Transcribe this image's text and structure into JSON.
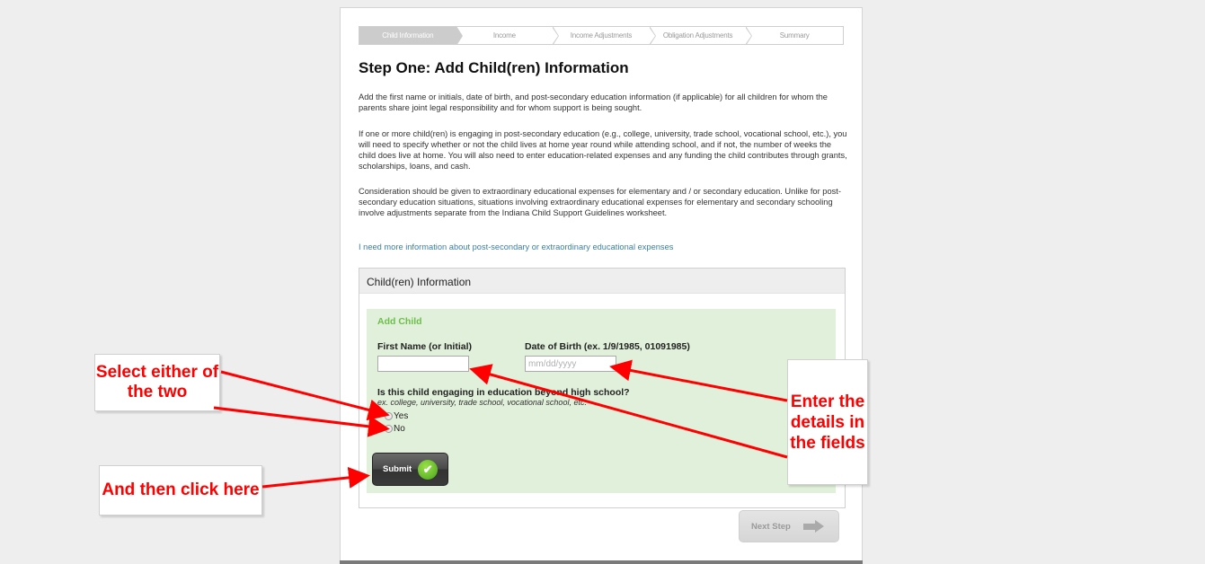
{
  "stepper": {
    "steps": [
      {
        "label": "Child Information",
        "active": true
      },
      {
        "label": "Income",
        "active": false
      },
      {
        "label": "Income Adjustments",
        "active": false
      },
      {
        "label": "Obligation Adjustments",
        "active": false
      },
      {
        "label": "Summary",
        "active": false
      }
    ]
  },
  "page": {
    "title": "Step One: Add Child(ren) Information",
    "paragraphs": [
      "Add the first name or initials, date of birth, and post-secondary education information (if applicable) for all children for whom the parents share joint legal responsibility and for whom support is being sought.",
      "If one or more child(ren) is engaging in post-secondary education (e.g., college, university, trade school, vocational school, etc.), you will need to specify whether or not the child lives at home year round while attending school, and if not, the number of weeks the child does live at home. You will also need to enter education-related expenses and any funding the child contributes through grants, scholarships, loans, and cash.",
      "Consideration should be given to extraordinary educational expenses for elementary and / or secondary education. Unlike for post-secondary education situations, situations involving extraordinary educational expenses for elementary and secondary schooling involve adjustments separate from the Indiana Child Support Guidelines worksheet."
    ],
    "info_link": "I need more information about post-secondary or extraordinary educational expenses"
  },
  "panel": {
    "title": "Child(ren) Information",
    "add_child": {
      "title": "Add Child",
      "first_name_label": "First Name (or Initial)",
      "first_name_value": "",
      "dob_label": "Date of Birth (ex. 1/9/1985, 01091985)",
      "dob_value": "",
      "dob_placeholder": "mm/dd/yyyy",
      "question": "Is this child engaging in education beyond high school?",
      "question_example": "ex. college, university, trade school, vocational school, etc.",
      "options": [
        {
          "label": "Yes",
          "selected": false
        },
        {
          "label": "No",
          "selected": false
        }
      ],
      "submit_label": "Submit",
      "submit_icon": "check-icon"
    }
  },
  "next_step": {
    "label": "Next Step",
    "icon": "arrow-right-icon",
    "enabled": false
  },
  "annotations": {
    "callout_radio": "Select either of the two",
    "callout_fields": "Enter the details in the fields",
    "callout_submit": "And then click here",
    "arrow_color": "#ff0000"
  }
}
